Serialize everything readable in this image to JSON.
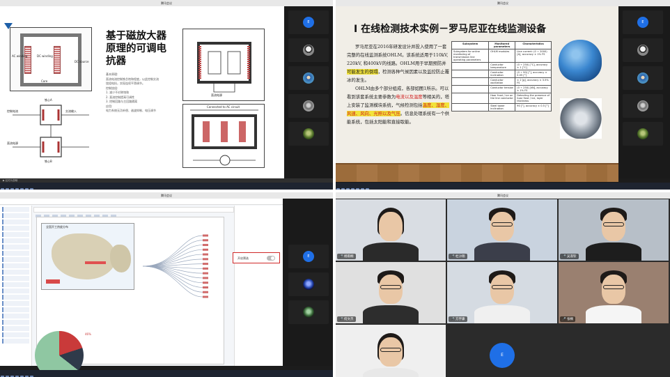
{
  "q1": {
    "window_title": "腾讯会议",
    "slide_title": "基于磁放大器原理的可调电抗器",
    "body_lines": [
      "基本原理:",
      "直流电流控制铁芯饱和程度，以此控制交流",
      "绕组电抗，实现连续平滑调节。",
      "控制绕组:",
      "1. 减少不对称饱和",
      "2. 直流控制提高可调性",
      "3. 控制回路与主回路隔离",
      "应用:",
      "电力系统无功补偿、谐波抑制、电压调节"
    ],
    "diagram_labels": {
      "ac_winding": "AC winding",
      "dc_winding": "DC winding",
      "dc_source": "DC source",
      "core": "Core",
      "iron_core_top": "铁心A",
      "iron_core_bottom": "铁心B",
      "control_winding": "控制电流",
      "ac_input": "交流输入",
      "dc_supply": "直流电源",
      "connected_ac": "Connected to AC circuit",
      "dc_source_right": "直流电源"
    },
    "statusbar": "▶ 幻灯片放映"
  },
  "q2": {
    "window_title": "腾讯会议",
    "slide_title": "I 在线检测技术实例－罗马尼亚在线监测设备",
    "para1_pre": "罗马尼亚在2016年研发设计并投入使用了一套完整的在线监测系统OHLM。该系统适用于110kV, 220kV, 和400kV的线路。OHLM用于早期预防并",
    "para1_hl": "可能发生的倒塌",
    "para1_post": "，检测各种气候因素以及监控防止覆冰的发生。",
    "para2_pre": "OHLM由多个部分组成，各部如图1所示。可以看到该套系统主要参数为",
    "para2_red1": "电流以及温度",
    "para2_mid": "等相关的，塔上安装了监测模块系统，气候检测包括",
    "para2_red2": "温度、湿度、风速、风向、光照以及气压",
    "para2_post": "。信息处理系统有一个供能系统，包括太阳能和直接取能。",
    "table": {
      "headers": [
        "Subsystem",
        "Monitored parameters",
        "Characteristics"
      ],
      "rows": [
        [
          "Subsystem for online monitoring of transmission line operating parameters",
          "OHLM modules",
          "Line current: (0 ÷ 2000) [A], accuracy ± 1% FS"
        ],
        [
          "",
          "Conductor temperature",
          "(0 ÷ 250) [°C], accuracy ± 1 [°C]"
        ],
        [
          "",
          "Conductor inclination",
          "(0 ÷ 90) [°], accuracy ± 0.05 [°]"
        ],
        [
          "",
          "Conductor oscillation",
          "± 2 [g], accuracy ± 3.5% FS"
        ],
        [
          "",
          "Conductor tension",
          "(0 ÷ 250) [kN], accuracy ± 1% FS"
        ],
        [
          "",
          "Hoar frost / ice on the line conductor",
          "Detecting the presence of hoar frost / ice, layer thickness"
        ],
        [
          "",
          "Steel tower inclination",
          "90 [°], accuracy ± 0.5 [°]"
        ]
      ]
    }
  },
  "q3": {
    "window_title": "腾讯会议",
    "map_title": "全国开工热度分布",
    "toggle_label": "开启筛选",
    "pie_label": "46%",
    "sidebar_rows": 22,
    "flow_lines": 14
  },
  "q4": {
    "window_title": "腾讯会议",
    "participants": [
      {
        "name": "杨雨桐",
        "type": "video",
        "shirt": "#2a2a2a",
        "bg": "#d9dde3",
        "glasses": false,
        "long_hair": true
      },
      {
        "name": "杜沙翔",
        "type": "video",
        "shirt": "#3b3e4a",
        "bg": "#c9d3df",
        "glasses": true,
        "long_hair": false
      },
      {
        "name": "吴淑钦",
        "type": "video",
        "shirt": "#1d1d1d",
        "bg": "#b7bfc8",
        "glasses": true,
        "long_hair": false
      },
      {
        "name": "何文杰",
        "type": "video",
        "shirt": "#2d2d2d",
        "bg": "#e0e0e0",
        "glasses": true,
        "long_hair": false
      },
      {
        "name": "方宇康",
        "type": "video",
        "shirt": "#f0f0f0",
        "bg": "#d5dbe2",
        "glasses": true,
        "long_hair": false
      },
      {
        "name": "张桐",
        "type": "video",
        "shirt": "#f5f5f5",
        "bg": "#9a8070",
        "glasses": true,
        "long_hair": false
      },
      {
        "name": "",
        "type": "video",
        "shirt": "#e8e8e8",
        "bg": "#efefef",
        "glasses": true,
        "long_hair": true
      },
      {
        "name": "E",
        "type": "avatar"
      }
    ]
  },
  "sidestrip_avatars": {
    "q1": [
      "E",
      "",
      "",
      "",
      ""
    ],
    "q2": [
      "E",
      "",
      "",
      "",
      ""
    ],
    "q3": [
      "E",
      "",
      ""
    ]
  },
  "colors": {
    "accent_blue": "#1f6fe6",
    "highlight": "#f2e33a",
    "red": "#d01c1c"
  }
}
